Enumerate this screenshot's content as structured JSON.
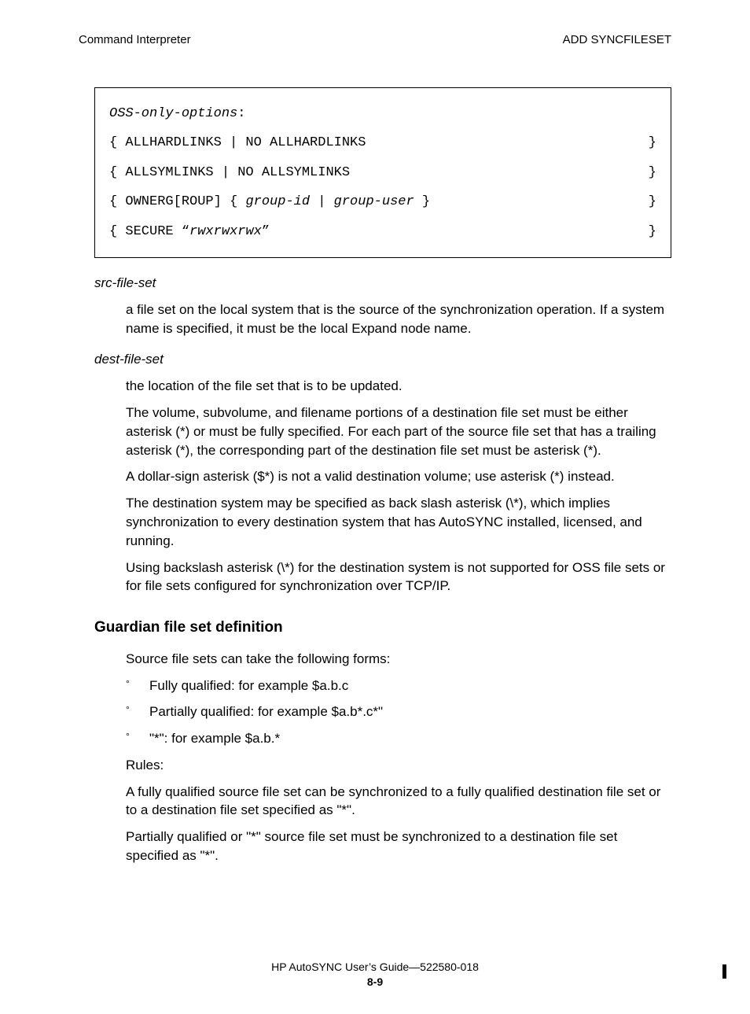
{
  "header": {
    "left": "Command Interpreter",
    "right": "ADD SYNCFILESET"
  },
  "codebox": {
    "title": "OSS-only-options",
    "colon": ":",
    "rows": [
      {
        "left_open": "{ ",
        "left": "ALLHARDLINKS | NO ALLHARDLINKS",
        "right": "}"
      },
      {
        "left_open": "{ ",
        "left": "ALLSYMLINKS | NO ALLSYMLINKS",
        "right": "}"
      },
      {
        "left_open": "{ ",
        "left_pre": "OWNERG[ROUP] { ",
        "left_italic": "group-id | group-user",
        "left_post": " }",
        "right": "}"
      },
      {
        "left_open": "{ ",
        "left_pre": "SECURE “",
        "left_italic": "rwxrwxrwx",
        "left_post": "”",
        "right": "}"
      }
    ]
  },
  "terms": {
    "src_label": "src-file-set",
    "src_def": "a file set on the local system that is the source of the synchronization operation. If a system name is specified, it must be the local Expand node name.",
    "dest_label": "dest-file-set",
    "dest_p1": "the location of the file set that is to be updated.",
    "dest_p2": "The volume, subvolume, and filename portions of a destination file set must be either asterisk (*) or must be fully specified. For each part of the source file set that has a trailing asterisk (*), the corresponding part of the destination file set must be asterisk (*).",
    "dest_p3": "A dollar-sign asterisk ($*) is not a valid destination volume; use asterisk (*) instead.",
    "dest_p4": "The destination system may be specified as back slash asterisk (\\*), which implies synchronization to every destination system that has AutoSYNC installed, licensed, and running.",
    "dest_p5": "Using backslash asterisk (\\*) for the destination system is not supported for OSS file sets or for file sets configured for synchronization over TCP/IP."
  },
  "guardian": {
    "heading": "Guardian file set definition",
    "intro": "Source file sets can take the following forms:",
    "items": [
      "Fully qualified: for example $a.b.c",
      "Partially qualified: for example $a.b*.c*\"",
      " \"*\": for example $a.b.*"
    ],
    "rules_label": "Rules:",
    "rules_p1": "A fully qualified source file set can be synchronized to a  fully qualified destination file set or to a destination file set specified as \"*\".",
    "rules_p2": "Partially qualified or \"*\" source file set must be synchronized to a destination file set specified as \"*\"."
  },
  "footer": {
    "title": "HP AutoSYNC User’s Guide—522580-018",
    "page": "8-9"
  }
}
